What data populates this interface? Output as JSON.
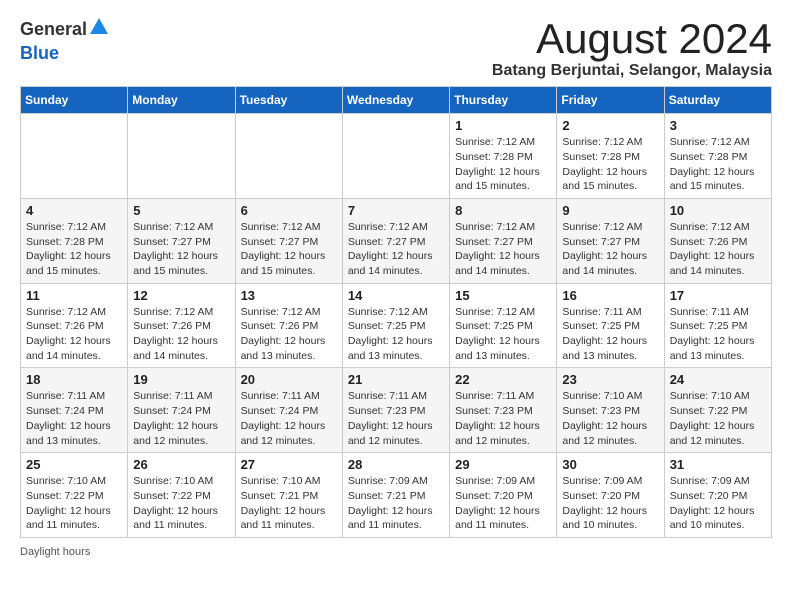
{
  "header": {
    "logo_general": "General",
    "logo_blue": "Blue",
    "title": "August 2024",
    "subtitle": "Batang Berjuntai, Selangor, Malaysia"
  },
  "days_of_week": [
    "Sunday",
    "Monday",
    "Tuesday",
    "Wednesday",
    "Thursday",
    "Friday",
    "Saturday"
  ],
  "weeks": [
    {
      "days": [
        {
          "date": "",
          "info": ""
        },
        {
          "date": "",
          "info": ""
        },
        {
          "date": "",
          "info": ""
        },
        {
          "date": "",
          "info": ""
        },
        {
          "date": "1",
          "info": "Sunrise: 7:12 AM\nSunset: 7:28 PM\nDaylight: 12 hours\nand 15 minutes."
        },
        {
          "date": "2",
          "info": "Sunrise: 7:12 AM\nSunset: 7:28 PM\nDaylight: 12 hours\nand 15 minutes."
        },
        {
          "date": "3",
          "info": "Sunrise: 7:12 AM\nSunset: 7:28 PM\nDaylight: 12 hours\nand 15 minutes."
        }
      ]
    },
    {
      "days": [
        {
          "date": "4",
          "info": "Sunrise: 7:12 AM\nSunset: 7:28 PM\nDaylight: 12 hours\nand 15 minutes."
        },
        {
          "date": "5",
          "info": "Sunrise: 7:12 AM\nSunset: 7:27 PM\nDaylight: 12 hours\nand 15 minutes."
        },
        {
          "date": "6",
          "info": "Sunrise: 7:12 AM\nSunset: 7:27 PM\nDaylight: 12 hours\nand 15 minutes."
        },
        {
          "date": "7",
          "info": "Sunrise: 7:12 AM\nSunset: 7:27 PM\nDaylight: 12 hours\nand 14 minutes."
        },
        {
          "date": "8",
          "info": "Sunrise: 7:12 AM\nSunset: 7:27 PM\nDaylight: 12 hours\nand 14 minutes."
        },
        {
          "date": "9",
          "info": "Sunrise: 7:12 AM\nSunset: 7:27 PM\nDaylight: 12 hours\nand 14 minutes."
        },
        {
          "date": "10",
          "info": "Sunrise: 7:12 AM\nSunset: 7:26 PM\nDaylight: 12 hours\nand 14 minutes."
        }
      ]
    },
    {
      "days": [
        {
          "date": "11",
          "info": "Sunrise: 7:12 AM\nSunset: 7:26 PM\nDaylight: 12 hours\nand 14 minutes."
        },
        {
          "date": "12",
          "info": "Sunrise: 7:12 AM\nSunset: 7:26 PM\nDaylight: 12 hours\nand 14 minutes."
        },
        {
          "date": "13",
          "info": "Sunrise: 7:12 AM\nSunset: 7:26 PM\nDaylight: 12 hours\nand 13 minutes."
        },
        {
          "date": "14",
          "info": "Sunrise: 7:12 AM\nSunset: 7:25 PM\nDaylight: 12 hours\nand 13 minutes."
        },
        {
          "date": "15",
          "info": "Sunrise: 7:12 AM\nSunset: 7:25 PM\nDaylight: 12 hours\nand 13 minutes."
        },
        {
          "date": "16",
          "info": "Sunrise: 7:11 AM\nSunset: 7:25 PM\nDaylight: 12 hours\nand 13 minutes."
        },
        {
          "date": "17",
          "info": "Sunrise: 7:11 AM\nSunset: 7:25 PM\nDaylight: 12 hours\nand 13 minutes."
        }
      ]
    },
    {
      "days": [
        {
          "date": "18",
          "info": "Sunrise: 7:11 AM\nSunset: 7:24 PM\nDaylight: 12 hours\nand 13 minutes."
        },
        {
          "date": "19",
          "info": "Sunrise: 7:11 AM\nSunset: 7:24 PM\nDaylight: 12 hours\nand 12 minutes."
        },
        {
          "date": "20",
          "info": "Sunrise: 7:11 AM\nSunset: 7:24 PM\nDaylight: 12 hours\nand 12 minutes."
        },
        {
          "date": "21",
          "info": "Sunrise: 7:11 AM\nSunset: 7:23 PM\nDaylight: 12 hours\nand 12 minutes."
        },
        {
          "date": "22",
          "info": "Sunrise: 7:11 AM\nSunset: 7:23 PM\nDaylight: 12 hours\nand 12 minutes."
        },
        {
          "date": "23",
          "info": "Sunrise: 7:10 AM\nSunset: 7:23 PM\nDaylight: 12 hours\nand 12 minutes."
        },
        {
          "date": "24",
          "info": "Sunrise: 7:10 AM\nSunset: 7:22 PM\nDaylight: 12 hours\nand 12 minutes."
        }
      ]
    },
    {
      "days": [
        {
          "date": "25",
          "info": "Sunrise: 7:10 AM\nSunset: 7:22 PM\nDaylight: 12 hours\nand 11 minutes."
        },
        {
          "date": "26",
          "info": "Sunrise: 7:10 AM\nSunset: 7:22 PM\nDaylight: 12 hours\nand 11 minutes."
        },
        {
          "date": "27",
          "info": "Sunrise: 7:10 AM\nSunset: 7:21 PM\nDaylight: 12 hours\nand 11 minutes."
        },
        {
          "date": "28",
          "info": "Sunrise: 7:09 AM\nSunset: 7:21 PM\nDaylight: 12 hours\nand 11 minutes."
        },
        {
          "date": "29",
          "info": "Sunrise: 7:09 AM\nSunset: 7:20 PM\nDaylight: 12 hours\nand 11 minutes."
        },
        {
          "date": "30",
          "info": "Sunrise: 7:09 AM\nSunset: 7:20 PM\nDaylight: 12 hours\nand 10 minutes."
        },
        {
          "date": "31",
          "info": "Sunrise: 7:09 AM\nSunset: 7:20 PM\nDaylight: 12 hours\nand 10 minutes."
        }
      ]
    }
  ],
  "footer": {
    "daylight_label": "Daylight hours"
  }
}
